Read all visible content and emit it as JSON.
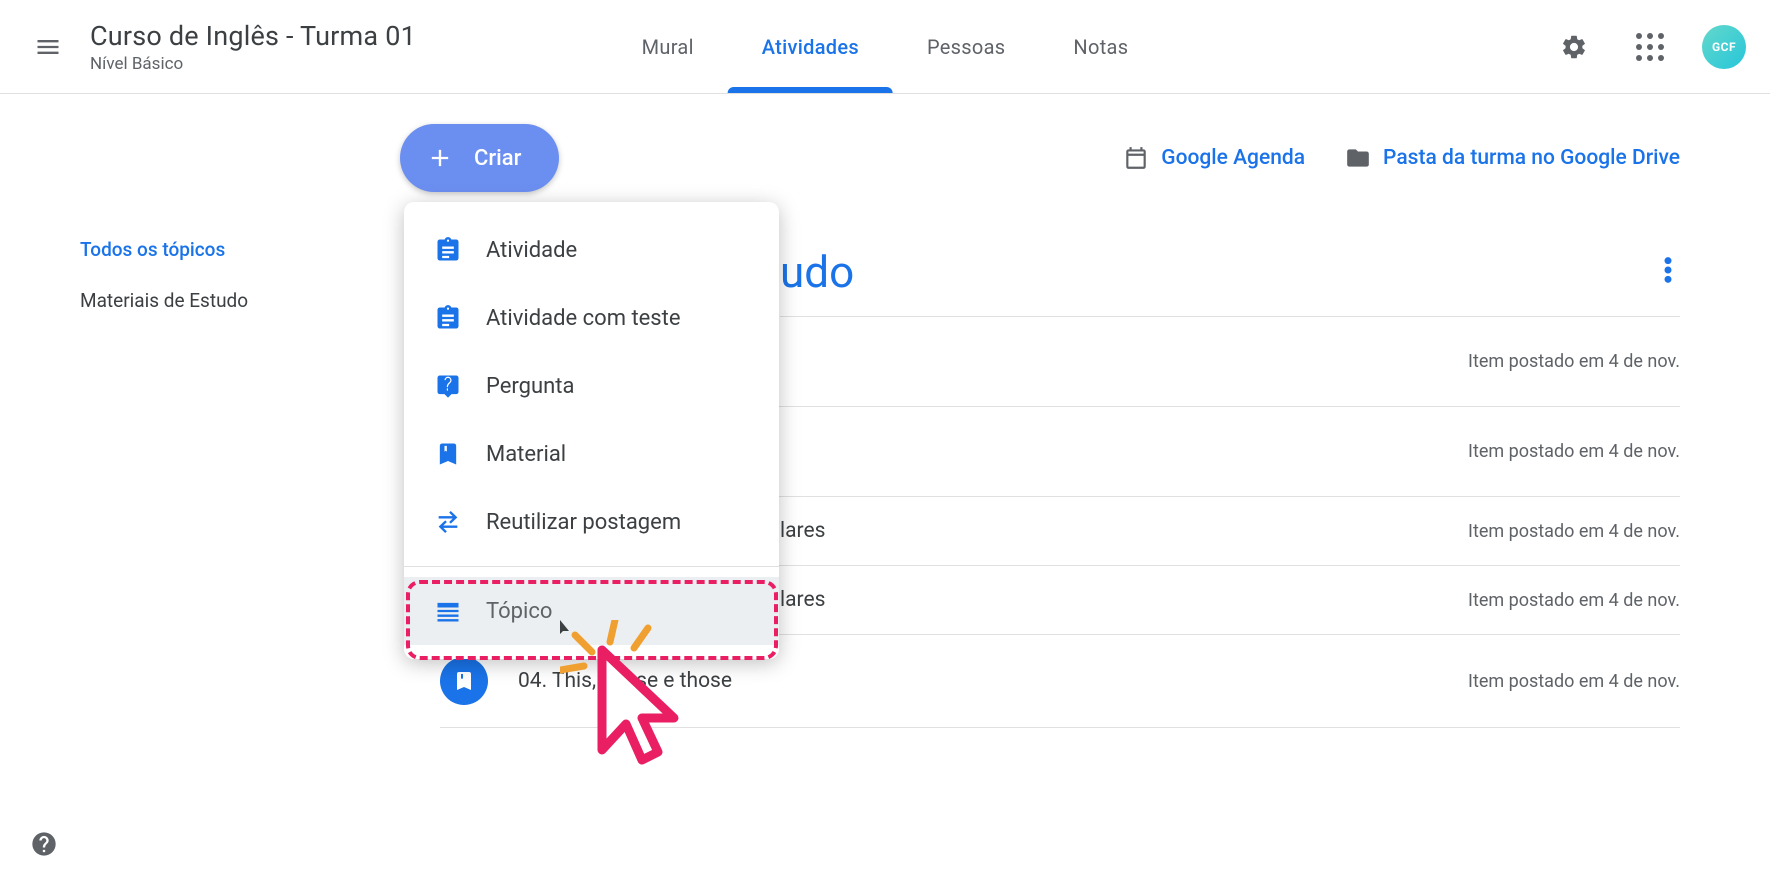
{
  "header": {
    "class_title": "Curso de Inglês - Turma 01",
    "class_subtitle": "Nível Básico",
    "tabs": {
      "mural": "Mural",
      "atividades": "Atividades",
      "pessoas": "Pessoas",
      "notas": "Notas"
    },
    "avatar_label": "GCF"
  },
  "sidebar": {
    "all_topics": "Todos os tópicos",
    "materials": "Materiais de Estudo"
  },
  "actions": {
    "create": "Criar",
    "calendar_link": "Google Agenda",
    "drive_link": "Pasta da turma no Google Drive"
  },
  "menu": {
    "assignment": "Atividade",
    "quiz_assignment": "Atividade com teste",
    "question": "Pergunta",
    "material": "Material",
    "reuse_post": "Reutilizar postagem",
    "topic": "Tópico"
  },
  "topic": {
    "title_partial": "udo"
  },
  "items": [
    {
      "title_partial": "",
      "posted": "Item postado em 4 de nov."
    },
    {
      "title_partial": "",
      "posted": "Item postado em 4 de nov."
    },
    {
      "title_partial": "lares",
      "posted": "Item postado em 4 de nov."
    },
    {
      "title_partial": "lares",
      "posted": "Item postado em 4 de nov."
    },
    {
      "title_partial": "04. This, t       hese e those",
      "posted": "Item postado em 4 de nov."
    }
  ]
}
